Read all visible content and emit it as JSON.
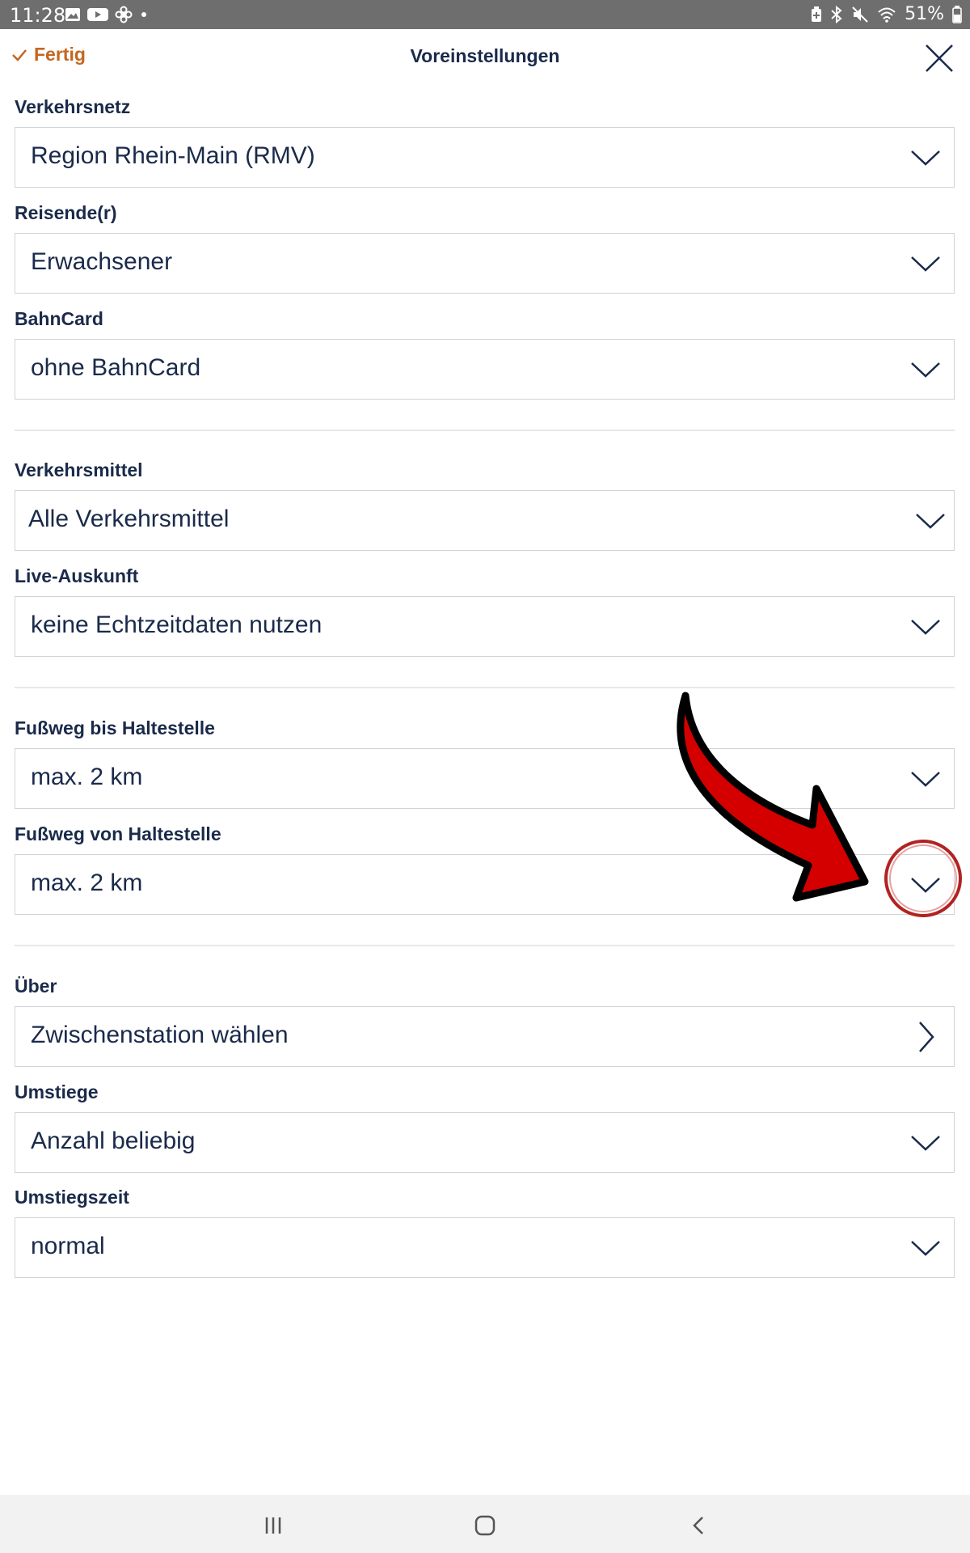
{
  "status_bar": {
    "time": "11:28",
    "battery": "51%",
    "left_icons": [
      "image-icon",
      "youtube-icon",
      "fan-icon",
      "dot-icon"
    ],
    "right_icons": [
      "battery-saver-icon",
      "bluetooth-icon",
      "mute-icon",
      "wifi-icon",
      "battery-icon"
    ]
  },
  "header": {
    "done_label": "Fertig",
    "title": "Voreinstellungen",
    "accent_color": "#c4661f",
    "text_color": "#1a2a4a"
  },
  "form": {
    "network": {
      "label": "Verkehrsnetz",
      "value": "Region Rhein-Main (RMV)"
    },
    "traveller": {
      "label": "Reisende(r)",
      "value": "Erwachsener"
    },
    "bahncard": {
      "label": "BahnCard",
      "value": "ohne BahnCard"
    },
    "transport": {
      "label": "Verkehrsmittel",
      "value": "Alle Verkehrsmittel"
    },
    "live": {
      "label": "Live-Auskunft",
      "value": "keine Echtzeitdaten nutzen"
    },
    "walk_to": {
      "label": "Fußweg bis Haltestelle",
      "value": "max. 2 km"
    },
    "walk_from": {
      "label": "Fußweg von Haltestelle",
      "value": "max. 2 km"
    },
    "via": {
      "label": "Über",
      "value": "Zwischenstation wählen"
    },
    "transfers": {
      "label": "Umstiege",
      "value": "Anzahl beliebig"
    },
    "transfer_time": {
      "label": "Umstiegszeit",
      "value": "normal"
    }
  },
  "annotation": {
    "arrow_color": "#d40000",
    "circle_color": "#b22222",
    "highlights": "walk_from dropdown chevron"
  },
  "navbar": {
    "icons": [
      "recent-apps-icon",
      "home-icon",
      "back-icon"
    ]
  }
}
